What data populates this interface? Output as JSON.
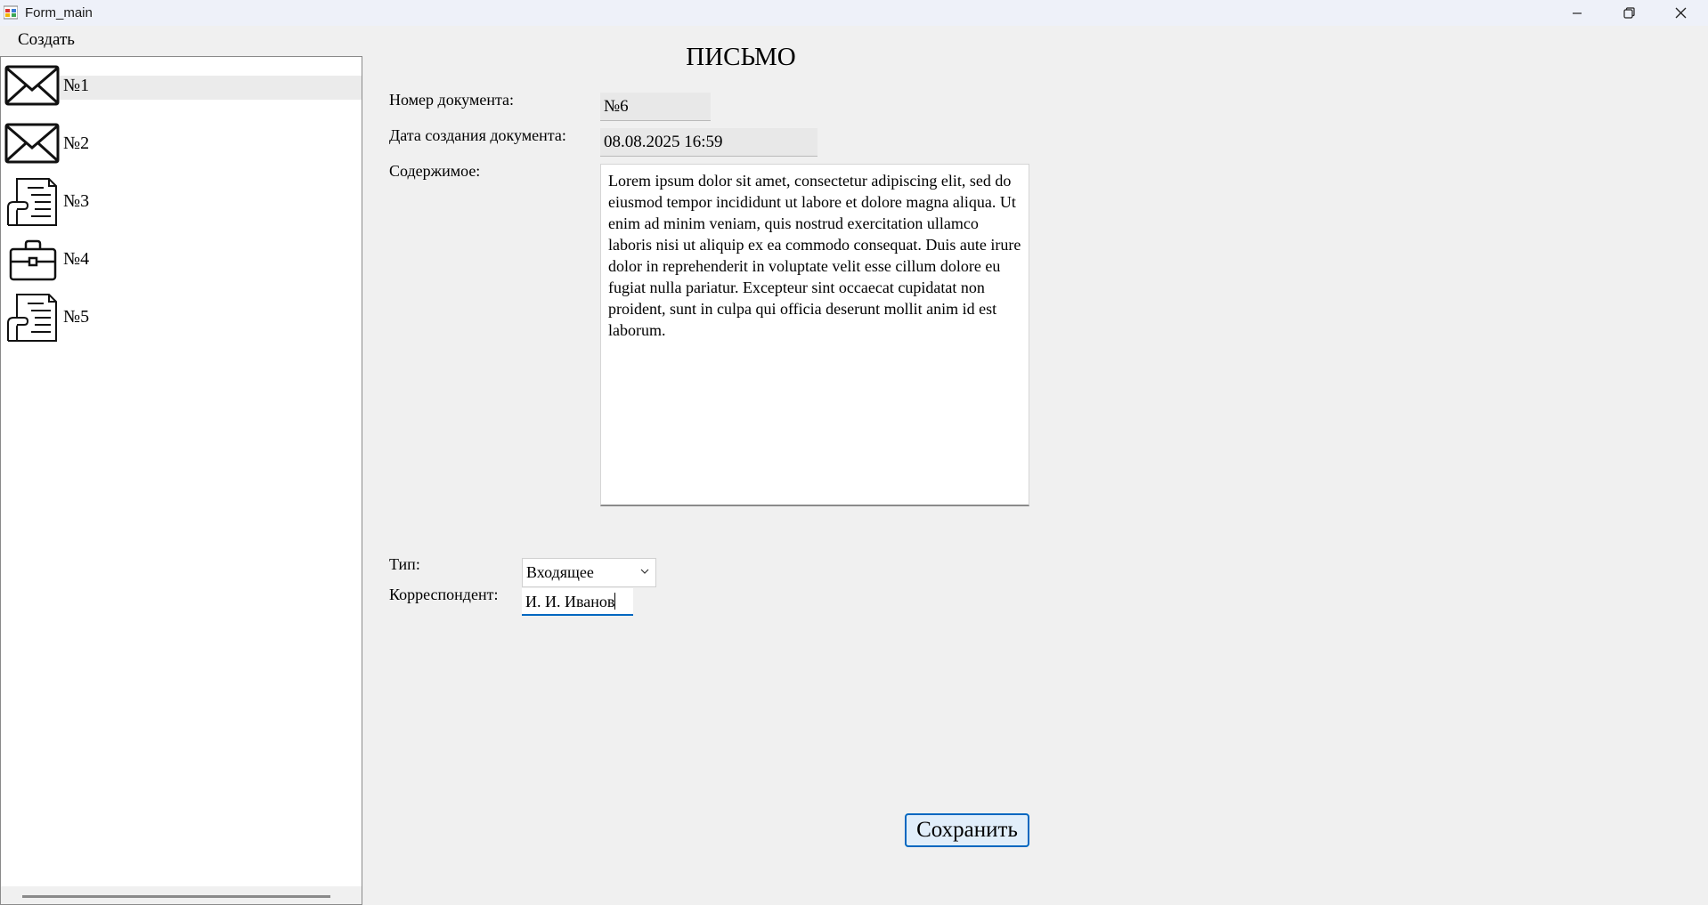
{
  "window": {
    "title": "Form_main"
  },
  "menu": {
    "create_label": "Создать"
  },
  "sidebar": {
    "items": [
      {
        "label": "№1",
        "icon": "envelope-icon",
        "selected": true
      },
      {
        "label": "№2",
        "icon": "envelope-icon",
        "selected": false
      },
      {
        "label": "№3",
        "icon": "document-icon",
        "selected": false
      },
      {
        "label": "№4",
        "icon": "briefcase-icon",
        "selected": false
      },
      {
        "label": "№5",
        "icon": "document-icon",
        "selected": false
      }
    ]
  },
  "form": {
    "heading": "ПИСЬМО",
    "doc_number_label": "Номер документа:",
    "doc_number_value": "№6",
    "created_label": "Дата создания документа:",
    "created_value": "08.08.2025 16:59",
    "content_label": "Содержимое:",
    "content_value": "Lorem ipsum dolor sit amet, consectetur adipiscing elit, sed do eiusmod tempor incididunt ut labore et dolore magna aliqua. Ut enim ad minim veniam, quis nostrud exercitation ullamco laboris nisi ut aliquip ex ea commodo consequat. Duis aute irure dolor in reprehenderit in voluptate velit esse cillum dolore eu fugiat nulla pariatur. Excepteur sint occaecat cupidatat non proident, sunt in culpa qui officia deserunt mollit anim id est laborum.",
    "type_label": "Тип:",
    "type_value": "Входящее",
    "correspondent_label": "Корреспондент:",
    "correspondent_value": "И. И. Иванов",
    "save_label": "Сохранить"
  },
  "colors": {
    "accent": "#0067c0",
    "button_bg": "#e1eefa",
    "window_bg": "#f0f0f0"
  }
}
